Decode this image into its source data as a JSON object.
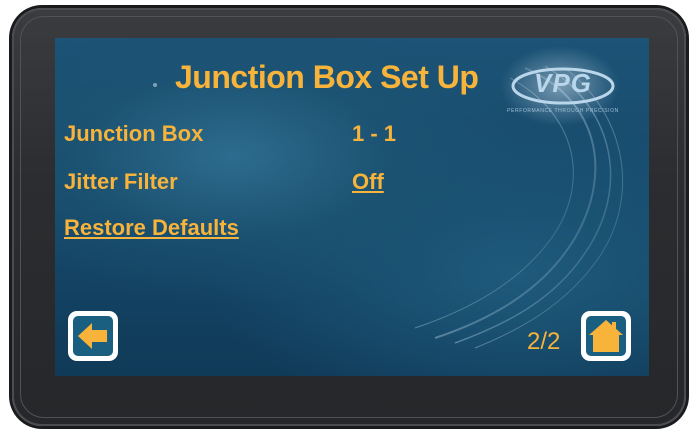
{
  "screen": {
    "title": "Junction Box Set Up",
    "logo": {
      "text": "VPG",
      "tagline": "PERFORMANCE THROUGH PRECISION"
    },
    "rows": [
      {
        "label": "Junction Box",
        "value": "1 - 1"
      },
      {
        "label": "Jitter Filter",
        "value": "Off"
      }
    ],
    "restore_defaults_label": "Restore Defaults",
    "page_indicator": "2/2"
  },
  "colors": {
    "accent": "#f7b33a",
    "screen_bg": "#1c5376",
    "bezel": "#2b2d30"
  },
  "icons": {
    "back": "left-arrow-icon",
    "home": "home-icon"
  }
}
